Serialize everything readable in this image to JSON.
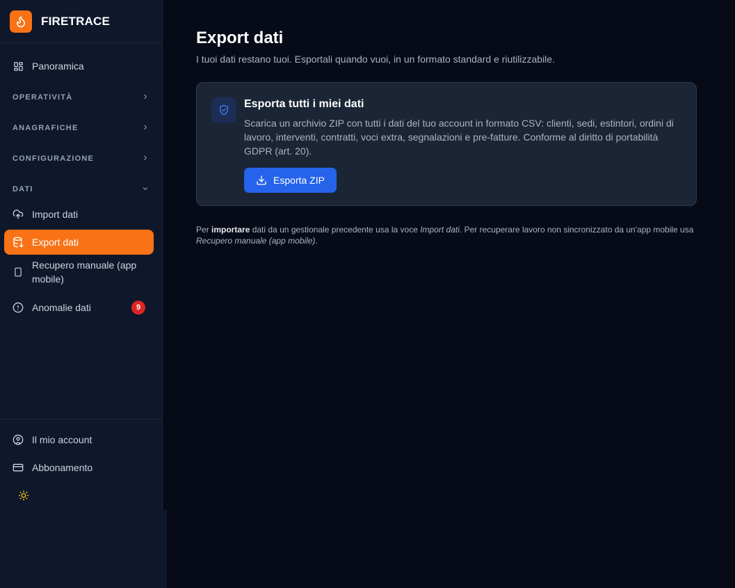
{
  "brand": {
    "name": "FIRETRACE",
    "color": "#f97316"
  },
  "nav": {
    "overview": "Panoramica",
    "sections": {
      "operativita": "OPERATIVITÀ",
      "anagrafiche": "ANAGRAFICHE",
      "configurazione": "CONFIGURAZIONE",
      "dati": "DATI"
    },
    "import": "Import dati",
    "export": "Export dati",
    "recovery": "Recupero manuale (app mobile)",
    "anomalies": "Anomalie dati",
    "anomalies_count": "9",
    "account": "Il mio account",
    "subscription": "Abbonamento"
  },
  "main": {
    "title": "Export dati",
    "subtitle": "I tuoi dati restano tuoi. Esportali quando vuoi, in un formato standard e riutilizzabile.",
    "card": {
      "title": "Esporta tutti i miei dati",
      "description": "Scarica un archivio ZIP con tutti i dati del tuo account in formato CSV: clienti, sedi, estintori, ordini di lavoro, interventi, contratti, voci extra, segnalazioni e pre-fatture. Conforme al diritto di portabilità GDPR (art. 20).",
      "button": "Esporta ZIP"
    },
    "note": {
      "p1": "Per ",
      "b1": "importare",
      "p2": " dati da un gestionale precedente usa la voce ",
      "i1": "Import dati",
      "p3": ". Per recuperare lavoro non sincronizzato da un'app mobile usa ",
      "i2": "Recupero manuale (app mobile)",
      "p4": "."
    }
  },
  "colors": {
    "accent": "#f97316",
    "primary": "#2563eb",
    "badge": "#dc2626"
  }
}
